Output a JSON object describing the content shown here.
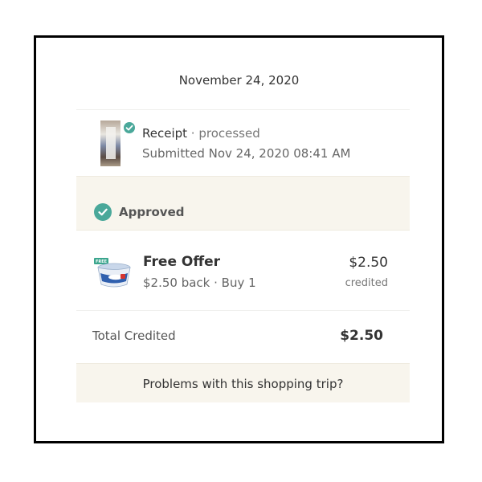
{
  "trip": {
    "date": "November 24, 2020"
  },
  "receipt": {
    "label": "Receipt",
    "separator": " · ",
    "status": "processed",
    "submitted": "Submitted Nov 24, 2020 08:41 AM",
    "thumbnail_icon": "receipt-photo-thumbnail",
    "status_icon": "check-circle-icon"
  },
  "approval": {
    "label": "Approved",
    "icon": "check-circle-icon",
    "icon_color": "#4aa89a"
  },
  "offer": {
    "title": "Free Offer",
    "details": "$2.50 back · Buy 1",
    "amount": "$2.50",
    "status": "credited",
    "badge": "FREE",
    "product_icon": "product-tub-icon"
  },
  "total": {
    "label": "Total Credited",
    "amount": "$2.50"
  },
  "help": {
    "link_label": "Problems with this shopping trip?"
  },
  "colors": {
    "accent": "#4aa89a",
    "band_background": "#f8f5ed",
    "frame_border": "#000000"
  }
}
